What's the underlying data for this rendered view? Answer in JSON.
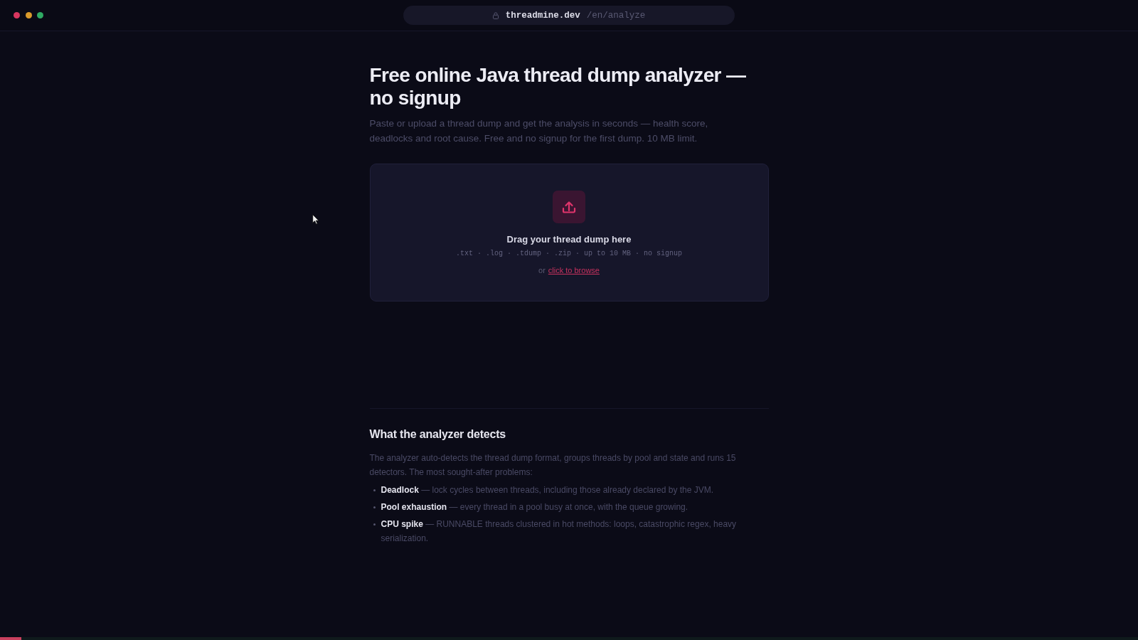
{
  "browser": {
    "domain": "threadmine.dev",
    "path": "/en/analyze"
  },
  "hero": {
    "title": "Free online Java thread dump analyzer — no signup",
    "intro": "Paste or upload a thread dump and get the analysis in seconds — health score, deadlocks and root cause. Free and no signup for the first dump. 10 MB limit."
  },
  "dropzone": {
    "heading": "Drag your thread dump here",
    "hint": ".txt · .log · .tdump · .zip · up to 10 MB · no signup",
    "prefix": "or",
    "browse_link": "click to browse"
  },
  "detects": {
    "heading": "What the analyzer detects",
    "intro": "The analyzer auto-detects the thread dump format, groups threads by pool and state and runs 15 detectors. The most sought-after problems:",
    "items": [
      "**Deadlock** — lock cycles between threads, including those already declared by the JVM.",
      "**Pool exhaustion** — every thread in a pool busy at once, with the queue growing.",
      "**CPU spike** — RUNNABLE threads clustered in hot methods: loops, catastrophic regex, heavy serialization."
    ]
  },
  "load_progress": {
    "level": 0.019
  }
}
